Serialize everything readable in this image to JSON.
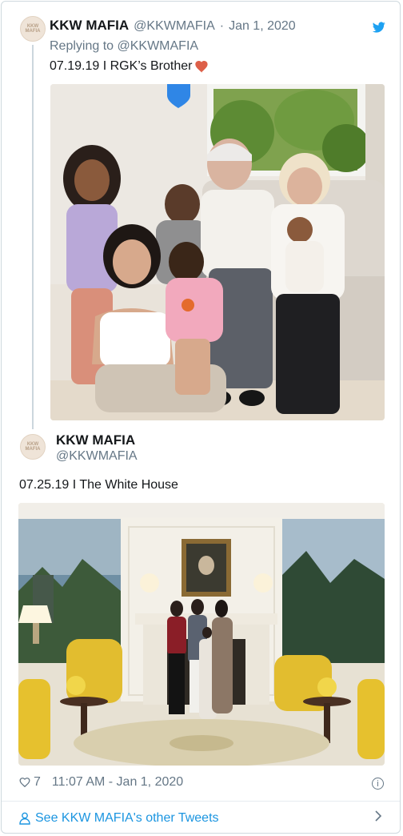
{
  "tweet1": {
    "display_name": "KKW MAFIA",
    "handle": "@KKWMAFIA",
    "date": "Jan 1, 2020",
    "separator": "·",
    "replying_to": "Replying to @KKWMAFIA",
    "text": "07.19.19 I RGK’s Brother",
    "avatar_text": "KKW MAFIA"
  },
  "tweet2": {
    "display_name": "KKW MAFIA",
    "handle": "@KKWMAFIA",
    "text": "07.25.19 I The White House",
    "avatar_text": "KKW MAFIA",
    "likes": "7",
    "timestamp": "11:07 AM - Jan 1, 2020"
  },
  "footer": {
    "see_more": "See KKW MAFIA's other Tweets"
  },
  "colors": {
    "link": "#1b95e0",
    "heart": "#e0245e",
    "muted": "#657786",
    "border": "#cfd9de"
  },
  "icons": [
    "twitter-bird-icon",
    "heart-emoji-icon",
    "heart-outline-icon",
    "info-icon",
    "person-icon",
    "chevron-right-icon"
  ]
}
